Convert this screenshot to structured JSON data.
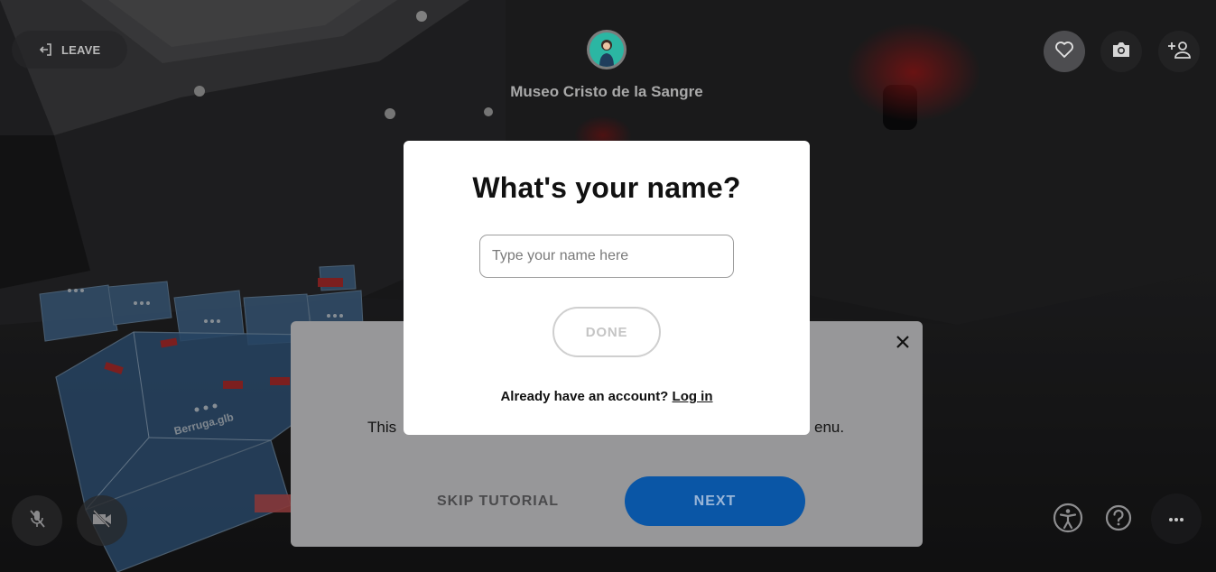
{
  "header": {
    "leave_label": "LEAVE",
    "room_title": "Museo Cristo de la Sangre"
  },
  "scene": {
    "model_labels": [
      "Berruga.glb"
    ]
  },
  "icons": {
    "leave": "exit-icon",
    "heart": "heart-icon",
    "camera": "camera-icon",
    "invite": "add-person-icon",
    "mic": "microphone-muted-icon",
    "video": "video-off-icon",
    "accessibility": "accessibility-icon",
    "help": "question-mark-icon",
    "more": "more-horizontal-icon",
    "close": "close-icon"
  },
  "tutorial": {
    "text_left": "This",
    "text_right": "enu.",
    "skip_label": "SKIP TUTORIAL",
    "next_label": "NEXT"
  },
  "name_modal": {
    "title": "What's your name?",
    "input_placeholder": "Type your name here",
    "input_value": "",
    "done_label": "DONE",
    "account_prompt": "Already have an account?",
    "login_label": "Log in"
  },
  "colors": {
    "accent": "#0a56a6",
    "modal_bg": "#ffffff",
    "avatar_bg": "#2bb6a3",
    "tutorial_bg": "#979799"
  }
}
